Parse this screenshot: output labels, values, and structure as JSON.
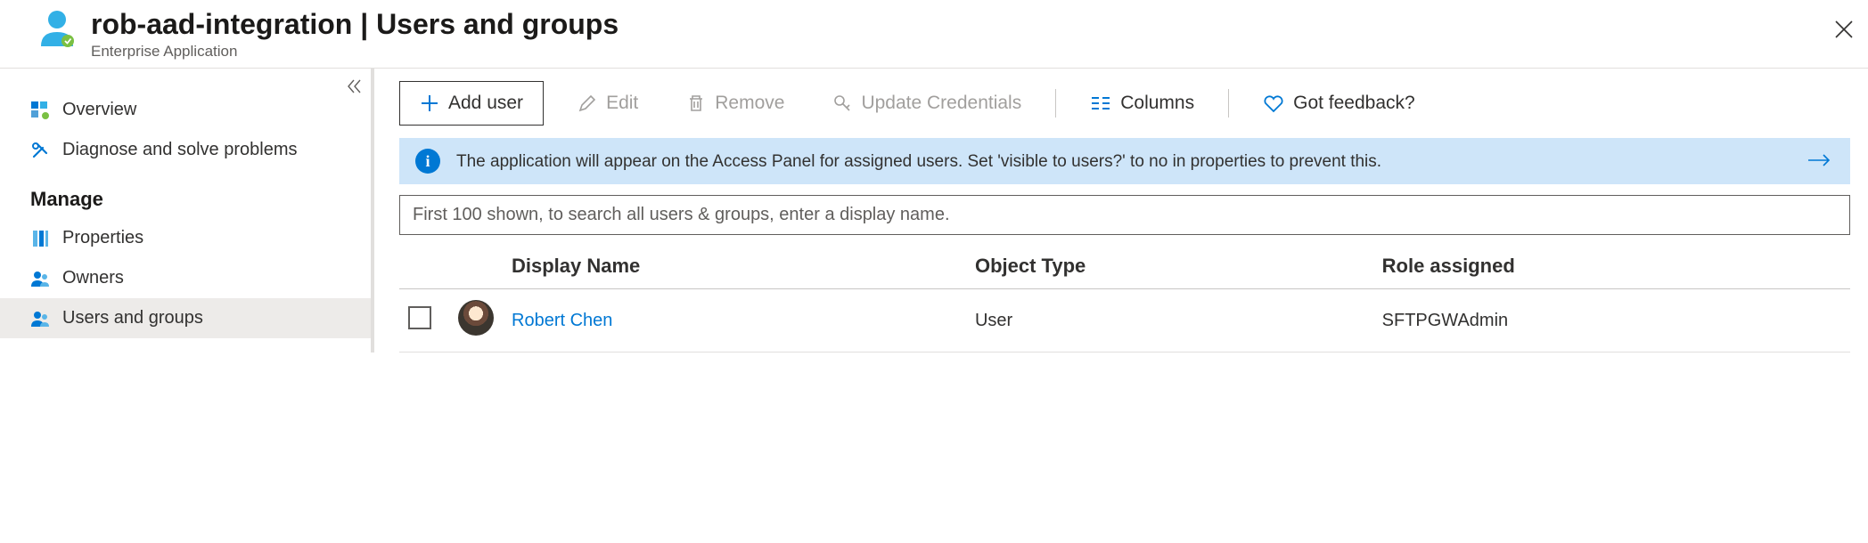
{
  "header": {
    "title": "rob-aad-integration | Users and groups",
    "subtitle": "Enterprise Application"
  },
  "sidebar": {
    "items": [
      {
        "label": "Overview",
        "icon": "overview-icon",
        "active": false
      },
      {
        "label": "Diagnose and solve problems",
        "icon": "tools-icon",
        "active": false
      }
    ],
    "section_manage": "Manage",
    "manage_items": [
      {
        "label": "Properties",
        "icon": "properties-icon",
        "active": false
      },
      {
        "label": "Owners",
        "icon": "owners-icon",
        "active": false
      },
      {
        "label": "Users and groups",
        "icon": "users-groups-icon",
        "active": true
      }
    ]
  },
  "toolbar": {
    "add_user": "Add user",
    "edit": "Edit",
    "remove": "Remove",
    "update_credentials": "Update Credentials",
    "columns": "Columns",
    "feedback": "Got feedback?"
  },
  "banner": {
    "text": "The application will appear on the Access Panel for assigned users. Set 'visible to users?' to no in properties to prevent this."
  },
  "search": {
    "placeholder": "First 100 shown, to search all users & groups, enter a display name."
  },
  "table": {
    "headers": {
      "display_name": "Display Name",
      "object_type": "Object Type",
      "role_assigned": "Role assigned"
    },
    "rows": [
      {
        "display_name": "Robert Chen",
        "object_type": "User",
        "role_assigned": "SFTPGWAdmin"
      }
    ]
  }
}
